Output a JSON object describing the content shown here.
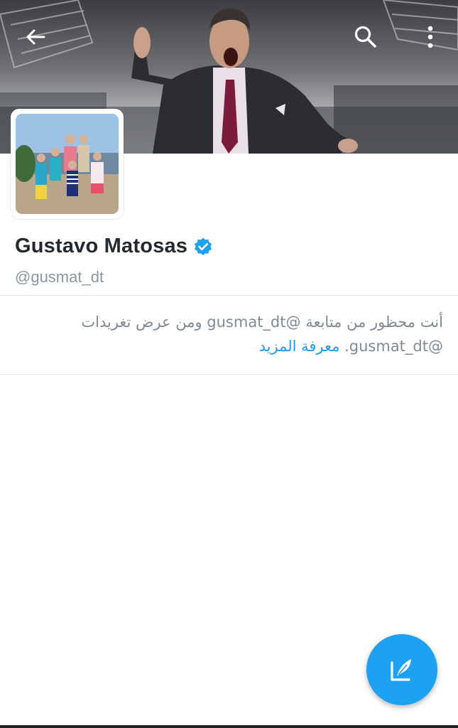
{
  "profile": {
    "display_name": "Gustavo Matosas",
    "handle": "@gusmat_dt",
    "verified": true
  },
  "toolbar": {
    "back_icon": "arrow-left-icon",
    "search_icon": "search-icon",
    "more_icon": "more-vertical-icon"
  },
  "notice": {
    "text": "أنت محظور من متابعة @gusmat_dt ومن عرض تغريدات @gusmat_dt.",
    "learn_more": "معرفة المزيد"
  },
  "fab": {
    "icon": "compose-tweet-icon"
  },
  "colors": {
    "accent": "#1da1f2",
    "link": "#1d9bf0",
    "name": "#23292e",
    "secondary_text": "#8b97a1"
  }
}
